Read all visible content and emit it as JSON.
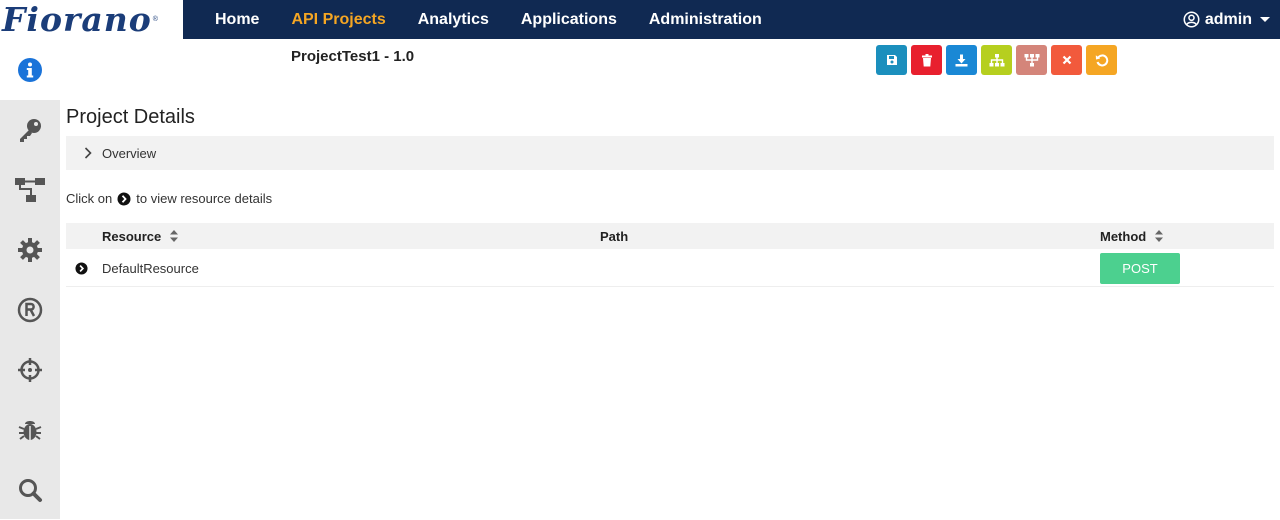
{
  "app": {
    "logo_text": "Fiorano",
    "logo_mark": "®"
  },
  "nav": {
    "items": [
      {
        "label": "Home",
        "active": false
      },
      {
        "label": "API Projects",
        "active": true
      },
      {
        "label": "Analytics",
        "active": false
      },
      {
        "label": "Applications",
        "active": false
      },
      {
        "label": "Administration",
        "active": false
      }
    ],
    "user_label": "admin"
  },
  "sidebar": {
    "items": [
      {
        "icon": "info-icon",
        "active": true
      },
      {
        "icon": "key-icon",
        "active": false
      },
      {
        "icon": "flow-icon",
        "active": false
      },
      {
        "icon": "gear-icon",
        "active": false
      },
      {
        "icon": "registered-icon",
        "active": false
      },
      {
        "icon": "crosshair-icon",
        "active": false
      },
      {
        "icon": "bug-icon",
        "active": false
      },
      {
        "icon": "search-icon",
        "active": false
      }
    ]
  },
  "project": {
    "title": "ProjectTest1 - 1.0"
  },
  "toolbar": {
    "buttons": [
      {
        "icon": "save-icon",
        "color": "#1b8fbd"
      },
      {
        "icon": "delete-icon",
        "color": "#e8202e"
      },
      {
        "icon": "download-icon",
        "color": "#1a88d5"
      },
      {
        "icon": "hierarchy-icon",
        "color": "#b6cf1f"
      },
      {
        "icon": "structure-icon",
        "color": "#d4857a"
      },
      {
        "icon": "close-icon",
        "color": "#f25a3c"
      },
      {
        "icon": "undo-icon",
        "color": "#f5a623"
      }
    ]
  },
  "details": {
    "section_title": "Project Details",
    "overview_label": "Overview",
    "hint_prefix": "Click on",
    "hint_suffix": "to view resource details"
  },
  "table": {
    "columns": [
      {
        "label": "Resource",
        "sortable": true
      },
      {
        "label": "Path",
        "sortable": false
      },
      {
        "label": "Method",
        "sortable": true
      }
    ],
    "rows": [
      {
        "resource": "DefaultResource",
        "path": "",
        "method": "POST"
      }
    ]
  },
  "colors": {
    "topbar": "#102952",
    "nav_active": "#f5a623",
    "method_post": "#4cd08f",
    "sidebar_bg": "#e8e8e8",
    "info_icon": "#1a73d9"
  }
}
